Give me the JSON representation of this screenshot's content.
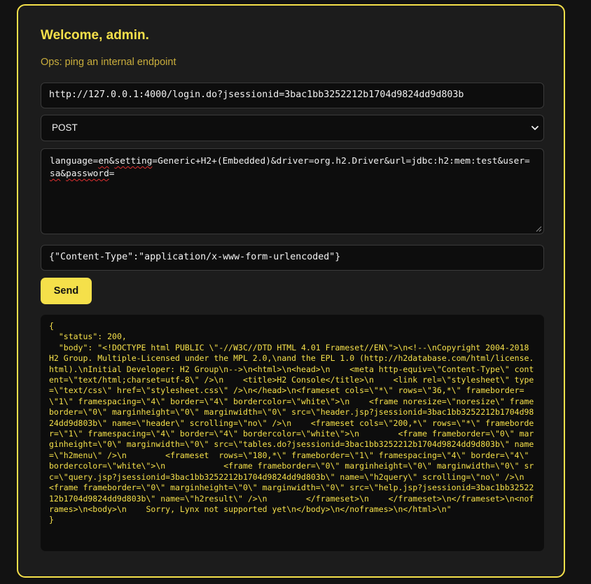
{
  "header": {
    "title": "Welcome, admin.",
    "subtitle": "Ops: ping an internal endpoint"
  },
  "form": {
    "url": "http://127.0.0.1:4000/login.do?jsessionid=3bac1bb3252212b1704d9824dd9d803b",
    "method": "POST",
    "body_parts": [
      "language=",
      "en",
      "&",
      "setting",
      "=Generic+H2+(Embedded)&driver=org.h2.Driver&url=jdbc:h2:mem:test&user=",
      "sa",
      "&",
      "password",
      "="
    ],
    "headers": "{\"Content-Type\":\"application/x-www-form-urlencoded\"}",
    "send_label": "Send"
  },
  "response": {
    "text": "{\n  \"status\": 200,\n  \"body\": \"<!DOCTYPE html PUBLIC \\\"-//W3C//DTD HTML 4.01 Frameset//EN\\\">\\n<!--\\nCopyright 2004-2018 H2 Group. Multiple-Licensed under the MPL 2.0,\\nand the EPL 1.0 (http://h2database.com/html/license.html).\\nInitial Developer: H2 Group\\n-->\\n<html>\\n<head>\\n    <meta http-equiv=\\\"Content-Type\\\" content=\\\"text/html;charset=utf-8\\\" />\\n    <title>H2 Console</title>\\n    <link rel=\\\"stylesheet\\\" type=\\\"text/css\\\" href=\\\"stylesheet.css\\\" />\\n</head>\\n<frameset cols=\\\"*\\\" rows=\\\"36,*\\\" frameborder=\\\"1\\\" framespacing=\\\"4\\\" border=\\\"4\\\" bordercolor=\\\"white\\\">\\n    <frame noresize=\\\"noresize\\\" frameborder=\\\"0\\\" marginheight=\\\"0\\\" marginwidth=\\\"0\\\" src=\\\"header.jsp?jsessionid=3bac1bb3252212b1704d9824dd9d803b\\\" name=\\\"header\\\" scrolling=\\\"no\\\" />\\n    <frameset cols=\\\"200,*\\\" rows=\\\"*\\\" frameborder=\\\"1\\\" framespacing=\\\"4\\\" border=\\\"4\\\" bordercolor=\\\"white\\\">\\n        <frame frameborder=\\\"0\\\" marginheight=\\\"0\\\" marginwidth=\\\"0\\\" src=\\\"tables.do?jsessionid=3bac1bb3252212b1704d9824dd9d803b\\\" name=\\\"h2menu\\\" />\\n        <frameset  rows=\\\"180,*\\\" frameborder=\\\"1\\\" framespacing=\\\"4\\\" border=\\\"4\\\" bordercolor=\\\"white\\\">\\n            <frame frameborder=\\\"0\\\" marginheight=\\\"0\\\" marginwidth=\\\"0\\\" src=\\\"query.jsp?jsessionid=3bac1bb3252212b1704d9824dd9d803b\\\" name=\\\"h2query\\\" scrolling=\\\"no\\\" />\\n            <frame frameborder=\\\"0\\\" marginheight=\\\"0\\\" marginwidth=\\\"0\\\" src=\\\"help.jsp?jsessionid=3bac1bb3252212b1704d9824dd9d803b\\\" name=\\\"h2result\\\" />\\n        </frameset>\\n    </frameset>\\n</frameset>\\n<noframes>\\n<body>\\n    Sorry, Lynx not supported yet\\n</body>\\n</noframes>\\n</html>\\n\"\n}"
  },
  "icons": {
    "method_dropdown": "chevron-down-icon",
    "body_resize": "resize-handle-icon"
  },
  "colors": {
    "accent": "#f5e04a",
    "subtitle": "#c9ad3c",
    "card_background": "#1c1c1c",
    "page_background": "#121212",
    "field_background": "#0d0d0d",
    "spellcheck_underline": "#e03030"
  }
}
